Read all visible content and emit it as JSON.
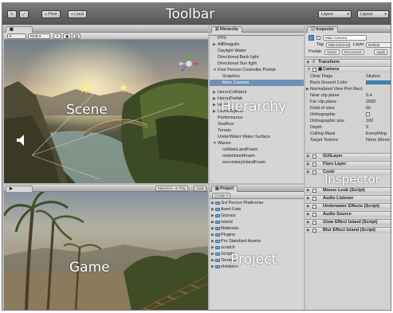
{
  "toolbar": {
    "label": "Toolbar",
    "pivot_label": "Pivot",
    "local_label": "Local",
    "layers_label": "Layers",
    "layout_label": "Layout"
  },
  "scene": {
    "label": "Scene",
    "render_mode": "RGB"
  },
  "game": {
    "label": "Game",
    "maximize_label": "Maximize on Play",
    "stats_label": "Stats"
  },
  "hierarchy": {
    "tab_label": "Hierarchy",
    "label": "Hierarchy",
    "items": [
      {
        "label": "FPS"
      },
      {
        "label": "AllBeagulls"
      },
      {
        "label": "Daylight Water"
      },
      {
        "label": "Directional Back light"
      },
      {
        "label": "Directional Sun light"
      },
      {
        "label": "First Person Controller Prefab"
      },
      {
        "label": "Graphics"
      },
      {
        "label": "Main Camera"
      },
      {
        "label": "HeronColliders"
      },
      {
        "label": "HeronPrefab"
      },
      {
        "label": "Island"
      },
      {
        "label": "LevelObjects"
      },
      {
        "label": "Performance"
      },
      {
        "label": "Seafloor"
      },
      {
        "label": "Terrain"
      },
      {
        "label": "UnderWater Water Surface"
      },
      {
        "label": "Waves"
      },
      {
        "label": "noMainLandFoam"
      },
      {
        "label": "mainIslandFoam"
      },
      {
        "label": "secondaryIslandFoam"
      }
    ]
  },
  "project": {
    "tab_label": "Project",
    "label": "Project",
    "create_label": "Create",
    "folders": [
      {
        "label": "3rd Person Platformer"
      },
      {
        "label": "Avert Fate"
      },
      {
        "label": "Gizmos"
      },
      {
        "label": "Island"
      },
      {
        "label": "Materials"
      },
      {
        "label": "Plugins"
      },
      {
        "label": "Pro Standard Assets"
      },
      {
        "label": "scratch"
      },
      {
        "label": "Scripts"
      },
      {
        "label": "Terrains"
      },
      {
        "label": "zHelpers"
      }
    ]
  },
  "inspector": {
    "tab_label": "Inspector",
    "label": "Inspector",
    "object_name": "Main Camera",
    "tag_label": "Tag",
    "tag_value": "MainCamera",
    "layer_label": "Layer",
    "layer_value": "Default",
    "prefab_label": "Prefab",
    "select_label": "Select",
    "reconnect_label": "Reconnect",
    "apply_label": "Apply",
    "transform_label": "Transform",
    "camera_label": "Camera",
    "camera_props": [
      {
        "label": "Clear Flags",
        "value": "Skybox"
      },
      {
        "label": "Back Ground Color",
        "value": ""
      },
      {
        "label": "Normalized View Port Rect",
        "value": ""
      },
      {
        "label": "Near clip plane",
        "value": "0.4"
      },
      {
        "label": "Far clip plane",
        "value": "2000"
      },
      {
        "label": "Field of view",
        "value": "60"
      },
      {
        "label": "Orthographic",
        "value": ""
      },
      {
        "label": "Orthographic size",
        "value": "100"
      },
      {
        "label": "Depth",
        "value": "0"
      },
      {
        "label": "Culling Mask",
        "value": "Everything"
      },
      {
        "label": "Target Texture",
        "value": "None (Rend"
      }
    ],
    "components": [
      {
        "label": "GUILayer"
      },
      {
        "label": "Flare Layer"
      },
      {
        "label": "Contr"
      },
      {
        "label": "Mouse Look (Script)"
      },
      {
        "label": "Audio Listener"
      },
      {
        "label": "Underwater Effects (Script)"
      },
      {
        "label": "Audio Source"
      },
      {
        "label": "Glow Effect Island (Script)"
      },
      {
        "label": "Blur Effect Island (Script)"
      }
    ],
    "bg_color": "#1e8fd8"
  }
}
